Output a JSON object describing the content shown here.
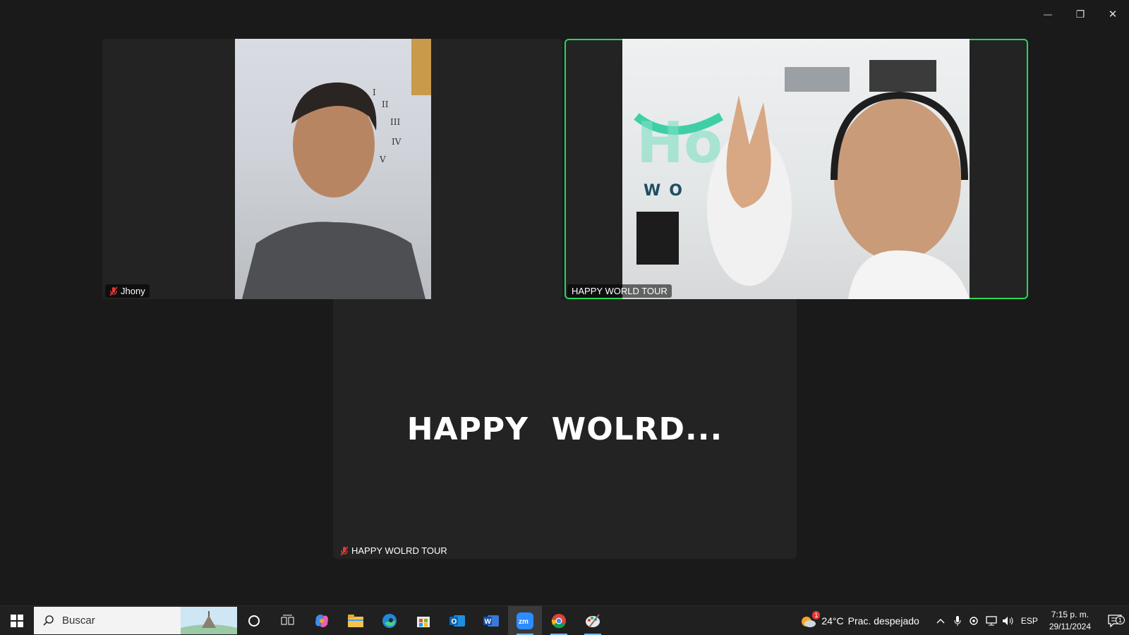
{
  "window_controls": {
    "minimize": "—",
    "restore": "❐",
    "close": "✕"
  },
  "participants": [
    {
      "name": "Jhony",
      "muted": true
    },
    {
      "name": "HAPPY WORLD TOUR",
      "muted": false,
      "active_speaker": true
    },
    {
      "name": "HAPPY WOLRD TOUR",
      "muted": true,
      "display_name_large": "HAPPY  WOLRD..."
    }
  ],
  "taskbar": {
    "search_placeholder": "Buscar",
    "apps": [
      "cortana-icon",
      "task-view-icon",
      "copilot-icon",
      "file-explorer-icon",
      "edge-icon",
      "store-icon",
      "outlook-icon",
      "word-icon",
      "zoom-icon",
      "chrome-icon",
      "paint-icon"
    ],
    "weather": {
      "temp": "24°C",
      "condition": "Prac. despejado",
      "badge": "1"
    },
    "language": "ESP",
    "time": "7:15 p. m.",
    "date": "29/11/2024",
    "notification_count": "1"
  },
  "colors": {
    "active_border": "#23d959",
    "background": "#1a1a1a",
    "tile": "#232323"
  }
}
